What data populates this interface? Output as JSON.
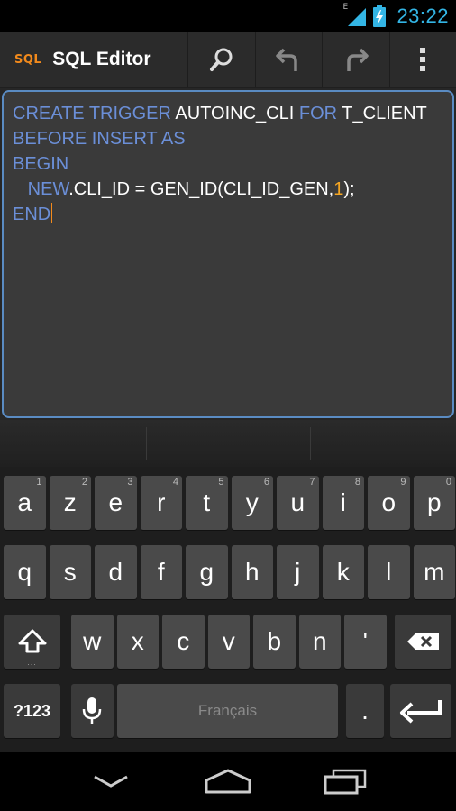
{
  "status_bar": {
    "time": "23:22",
    "network": "E"
  },
  "action_bar": {
    "logo": "SQL",
    "title": "SQL Editor",
    "actions": [
      "search-icon",
      "undo-icon",
      "redo-icon",
      "overflow-menu-icon"
    ]
  },
  "editor": {
    "lines": [
      [
        {
          "t": "CREATE TRIGGER ",
          "kw": true
        },
        {
          "t": "AUTOINC_CLI "
        },
        {
          "t": "FOR ",
          "kw": true
        },
        {
          "t": "T_CLIENT"
        }
      ],
      [
        {
          "t": "BEFORE INSERT AS",
          "kw": true
        }
      ],
      [
        {
          "t": "BEGIN",
          "kw": true
        }
      ],
      [
        {
          "t": "   "
        },
        {
          "t": "NEW",
          "kw": true
        },
        {
          "t": ".CLI_ID = GEN_ID(CLI_ID_GEN,"
        },
        {
          "t": "1",
          "num": true
        },
        {
          "t": ");"
        }
      ],
      [
        {
          "t": "END",
          "kw": true
        }
      ]
    ]
  },
  "keyboard": {
    "row1": [
      {
        "label": "a",
        "hint": "1"
      },
      {
        "label": "z",
        "hint": "2"
      },
      {
        "label": "e",
        "hint": "3"
      },
      {
        "label": "r",
        "hint": "4"
      },
      {
        "label": "t",
        "hint": "5"
      },
      {
        "label": "y",
        "hint": "6"
      },
      {
        "label": "u",
        "hint": "7"
      },
      {
        "label": "i",
        "hint": "8"
      },
      {
        "label": "o",
        "hint": "9"
      },
      {
        "label": "p",
        "hint": "0"
      }
    ],
    "row2": [
      "q",
      "s",
      "d",
      "f",
      "g",
      "h",
      "j",
      "k",
      "l",
      "m"
    ],
    "row3": [
      "w",
      "x",
      "c",
      "v",
      "b",
      "n",
      "'"
    ],
    "symbols_label": "?123",
    "space_label": "Français",
    "period_label": "."
  },
  "colors": {
    "keyword": "#6b8fd8",
    "number": "#f5a623",
    "accent": "#33b5e5",
    "editor_border": "#5a8bc2",
    "logo": "#f28a1c"
  }
}
